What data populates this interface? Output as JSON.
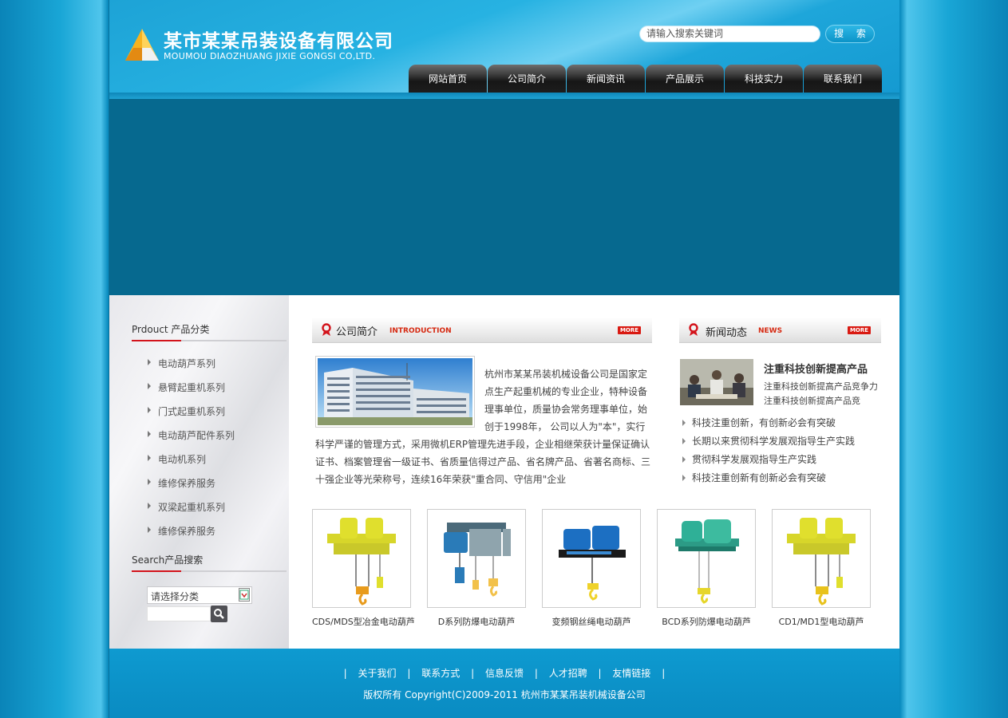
{
  "header": {
    "company_cn": "某市某某吊装设备有限公司",
    "company_en": "MOUMOU DIAOZHUANG JIXIE GONGSI CO,LTD.",
    "search_placeholder": "请输入搜索关键词",
    "search_button": "搜 索"
  },
  "nav": [
    "网站首页",
    "公司简介",
    "新闻资讯",
    "产品展示",
    "科技实力",
    "联系我们"
  ],
  "sidebar": {
    "categories_title": "Prdouct 产品分类",
    "categories": [
      "电动葫芦系列",
      "悬臂起重机系列",
      "门式起重机系列",
      "电动葫芦配件系列",
      "电动机系列",
      "维修保养服务",
      "双梁起重机系列",
      "维修保养服务"
    ],
    "search_title": "Search产品搜索",
    "select_value": "请选择分类"
  },
  "intro": {
    "title_cn": "公司简介",
    "title_en": "INTRODUCTION",
    "more": "MORE",
    "text": "杭州市某某吊装机械设备公司是国家定点生产起重机械的专业企业，特种设备理事单位，质量协会常务理事单位，始创于1998年， 公司以人为\"本\"，实行科学严谨的管理方式，采用微机ERP管理先进手段，企业相继荣获计量保证确认证书、档案管理省一级证书、省质量信得过产品、省名牌产品、省著名商标、三十强企业等光荣称号，连续16年荣获\"重合同、守信用\"企业"
  },
  "news": {
    "title_cn": "新闻动态",
    "title_en": "NEWS",
    "more": "MORE",
    "headline": "注重科技创新提高产品",
    "summary": "注重科技创新提高产品竞争力注重科技创新提高产品竞",
    "items": [
      "科技注重创新，有创新必会有突破",
      "长期以来贯彻科学发展观指导生产实践",
      "贯彻科学发展观指导生产实践",
      "科技注重创新有创新必会有突破"
    ]
  },
  "products": [
    "CDS/MDS型冶金电动葫芦",
    "D系列防爆电动葫芦",
    "变频钢丝绳电动葫芦",
    "BCD系列防爆电动葫芦",
    "CD1/MD1型电动葫芦"
  ],
  "footer": {
    "links": [
      "关于我们",
      "联系方式",
      "信息反馈",
      "人才招聘",
      "友情链接"
    ],
    "copyright": "版权所有 Copyright(C)2009-2011 杭州市某某吊装机械设备公司"
  }
}
